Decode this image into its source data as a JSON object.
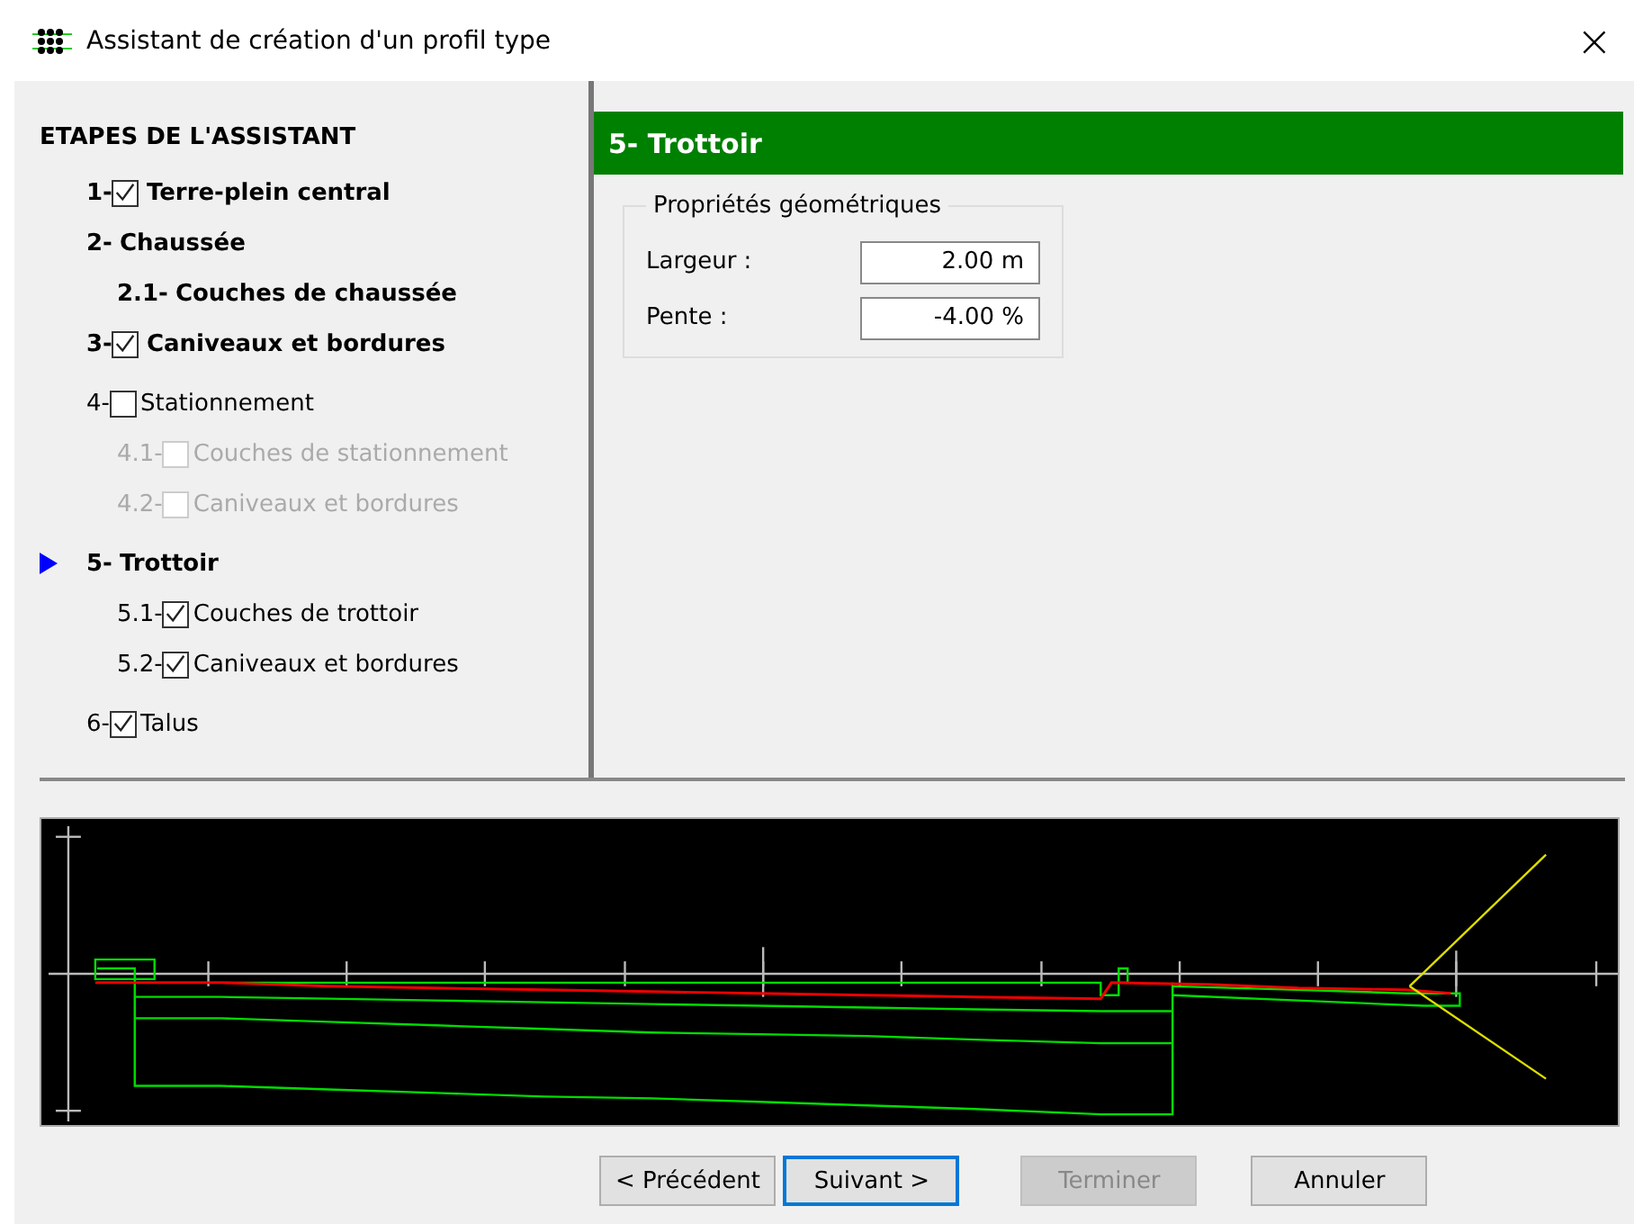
{
  "window": {
    "title": "Assistant de création d'un profil type",
    "close": "×"
  },
  "steps_title": "ETAPES DE L'ASSISTANT",
  "steps": [
    {
      "number": "1-",
      "label": "Terre-plein central",
      "bold": true,
      "checked": true,
      "disabled": false,
      "selected": false
    },
    {
      "number": "2-",
      "label": "Chaussée",
      "bold": true,
      "disabled": false,
      "selected": false,
      "children": [
        {
          "number": "2.1-",
          "label": "Couches de chaussée",
          "bold": true,
          "disabled": false
        }
      ]
    },
    {
      "number": "3-",
      "label": "Caniveaux et bordures",
      "bold": true,
      "checked": true,
      "disabled": false,
      "selected": false
    },
    {
      "number": "4-",
      "label": "Stationnement",
      "bold": false,
      "checked": false,
      "disabled": false,
      "selected": false,
      "children": [
        {
          "number": "4.1-",
          "label": "Couches de stationnement",
          "bold": false,
          "checked": false,
          "disabled": true
        },
        {
          "number": "4.2-",
          "label": "Caniveaux et bordures",
          "bold": false,
          "checked": false,
          "disabled": true
        }
      ]
    },
    {
      "number": "5-",
      "label": "Trottoir",
      "bold": true,
      "disabled": false,
      "selected": true,
      "children": [
        {
          "number": "5.1-",
          "label": "Couches de trottoir",
          "bold": false,
          "checked": true,
          "disabled": false
        },
        {
          "number": "5.2-",
          "label": "Caniveaux et bordures",
          "bold": false,
          "checked": true,
          "disabled": false
        }
      ]
    },
    {
      "number": "6-",
      "label": "Talus",
      "bold": false,
      "checked": true,
      "disabled": false,
      "selected": false
    }
  ],
  "panel": {
    "title": "5- Trottoir",
    "group": "Propriétés géométriques",
    "fields": [
      {
        "label": "Largeur :",
        "value": "2.00 m"
      },
      {
        "label": "Pente :",
        "value": "-4.00 %"
      }
    ]
  },
  "buttons": [
    {
      "label": "< Précédent",
      "kind": "normal",
      "disabled": false
    },
    {
      "label": "Suivant >",
      "kind": "default",
      "disabled": false
    },
    {
      "label": "Terminer",
      "kind": "spaced",
      "disabled": true
    },
    {
      "label": "Annuler",
      "kind": "spaced",
      "disabled": false
    }
  ]
}
